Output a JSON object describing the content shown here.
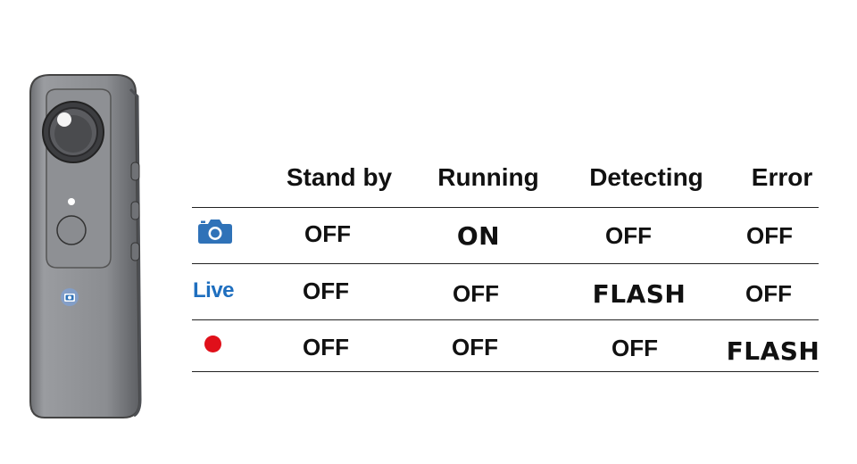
{
  "columns": [
    "Stand by",
    "Running",
    "Detecting",
    "Error"
  ],
  "rows": [
    {
      "icon": "camera-icon",
      "values": [
        "OFF",
        "ON",
        "OFF",
        "OFF"
      ]
    },
    {
      "icon": "live-icon",
      "label": "Live",
      "values": [
        "OFF",
        "OFF",
        "FLASH",
        "OFF"
      ]
    },
    {
      "icon": "record-dot-icon",
      "values": [
        "OFF",
        "OFF",
        "OFF",
        "FLASH"
      ]
    }
  ],
  "colors": {
    "device_body": "#8a8c90",
    "camera_blue": "#2f72b8",
    "live_blue": "#1f6fbf",
    "record_red": "#e0101a"
  }
}
